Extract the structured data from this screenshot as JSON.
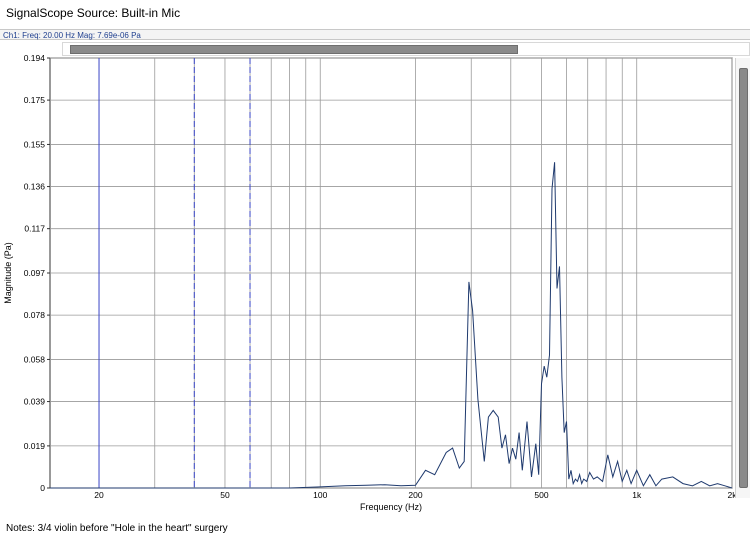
{
  "app": {
    "title": "SignalScope Source:  Built-in Mic",
    "readout": "Ch1:  Freq: 20.00 Hz   Mag: 7.69e-06 Pa",
    "notes": "Notes: 3/4 violin before \"Hole in the heart\" surgery"
  },
  "colors": {
    "trace": "#1f3a6e",
    "cursor": "#3a46c8",
    "grid": "#9a9a9a",
    "plot_border": "#333333"
  },
  "chart_data": {
    "type": "line",
    "title": "",
    "xlabel": "Frequency (Hz)",
    "ylabel": "Magnitude (Pa)",
    "x_scale": "log",
    "xlim": [
      14,
      2000
    ],
    "ylim": [
      0,
      0.194
    ],
    "grid": true,
    "x_tick_labels": [
      {
        "value": 20,
        "label": "20"
      },
      {
        "value": 50,
        "label": "50"
      },
      {
        "value": 100,
        "label": "100"
      },
      {
        "value": 200,
        "label": "200"
      },
      {
        "value": 500,
        "label": "500"
      },
      {
        "value": 1000,
        "label": "1k"
      },
      {
        "value": 2000,
        "label": "2k"
      }
    ],
    "y_ticks": [
      {
        "value": 0,
        "label": "0"
      },
      {
        "value": 0.019,
        "label": "0.019"
      },
      {
        "value": 0.039,
        "label": "0.039"
      },
      {
        "value": 0.058,
        "label": "0.058"
      },
      {
        "value": 0.078,
        "label": "0.078"
      },
      {
        "value": 0.097,
        "label": "0.097"
      },
      {
        "value": 0.117,
        "label": "0.117"
      },
      {
        "value": 0.136,
        "label": "0.136"
      },
      {
        "value": 0.155,
        "label": "0.155"
      },
      {
        "value": 0.175,
        "label": "0.175"
      },
      {
        "value": 0.194,
        "label": "0.194"
      }
    ],
    "grid_x": [
      20,
      30,
      40,
      50,
      60,
      70,
      80,
      90,
      100,
      200,
      300,
      400,
      500,
      600,
      700,
      800,
      900,
      1000,
      2000
    ],
    "cursors": [
      {
        "x": 20,
        "style": "solid"
      },
      {
        "x": 40,
        "style": "dashed"
      },
      {
        "x": 60,
        "style": "dashed"
      }
    ],
    "series": [
      {
        "x": [
          14,
          20,
          30,
          50,
          80,
          100,
          120,
          140,
          160,
          180,
          200,
          215,
          230,
          250,
          262,
          275,
          285,
          295,
          303,
          315,
          330,
          340,
          352,
          365,
          375,
          385,
          395,
          405,
          415,
          425,
          435,
          450,
          465,
          480,
          490,
          500,
          510,
          520,
          530,
          540,
          550,
          560,
          570,
          580,
          590,
          600,
          610,
          620,
          630,
          640,
          650,
          660,
          670,
          680,
          695,
          710,
          730,
          750,
          780,
          810,
          840,
          870,
          900,
          930,
          960,
          1000,
          1050,
          1100,
          1150,
          1200,
          1300,
          1400,
          1500,
          1600,
          1700,
          1800,
          1900,
          2000
        ],
        "y": [
          0,
          0,
          0,
          0,
          0,
          0.0005,
          0.001,
          0.0012,
          0.0015,
          0.001,
          0.0012,
          0.008,
          0.006,
          0.016,
          0.018,
          0.009,
          0.012,
          0.093,
          0.08,
          0.04,
          0.012,
          0.032,
          0.035,
          0.032,
          0.018,
          0.024,
          0.011,
          0.018,
          0.013,
          0.025,
          0.008,
          0.03,
          0.005,
          0.02,
          0.006,
          0.047,
          0.055,
          0.05,
          0.06,
          0.135,
          0.147,
          0.09,
          0.1,
          0.05,
          0.025,
          0.03,
          0.004,
          0.008,
          0.002,
          0.004,
          0.003,
          0.006,
          0.002,
          0.004,
          0.003,
          0.007,
          0.004,
          0.005,
          0.003,
          0.015,
          0.005,
          0.012,
          0.003,
          0.008,
          0.002,
          0.008,
          0.001,
          0.006,
          0.001,
          0.004,
          0.005,
          0.002,
          0.001,
          0.003,
          0.001,
          0.002,
          0.001,
          0
        ]
      }
    ]
  }
}
